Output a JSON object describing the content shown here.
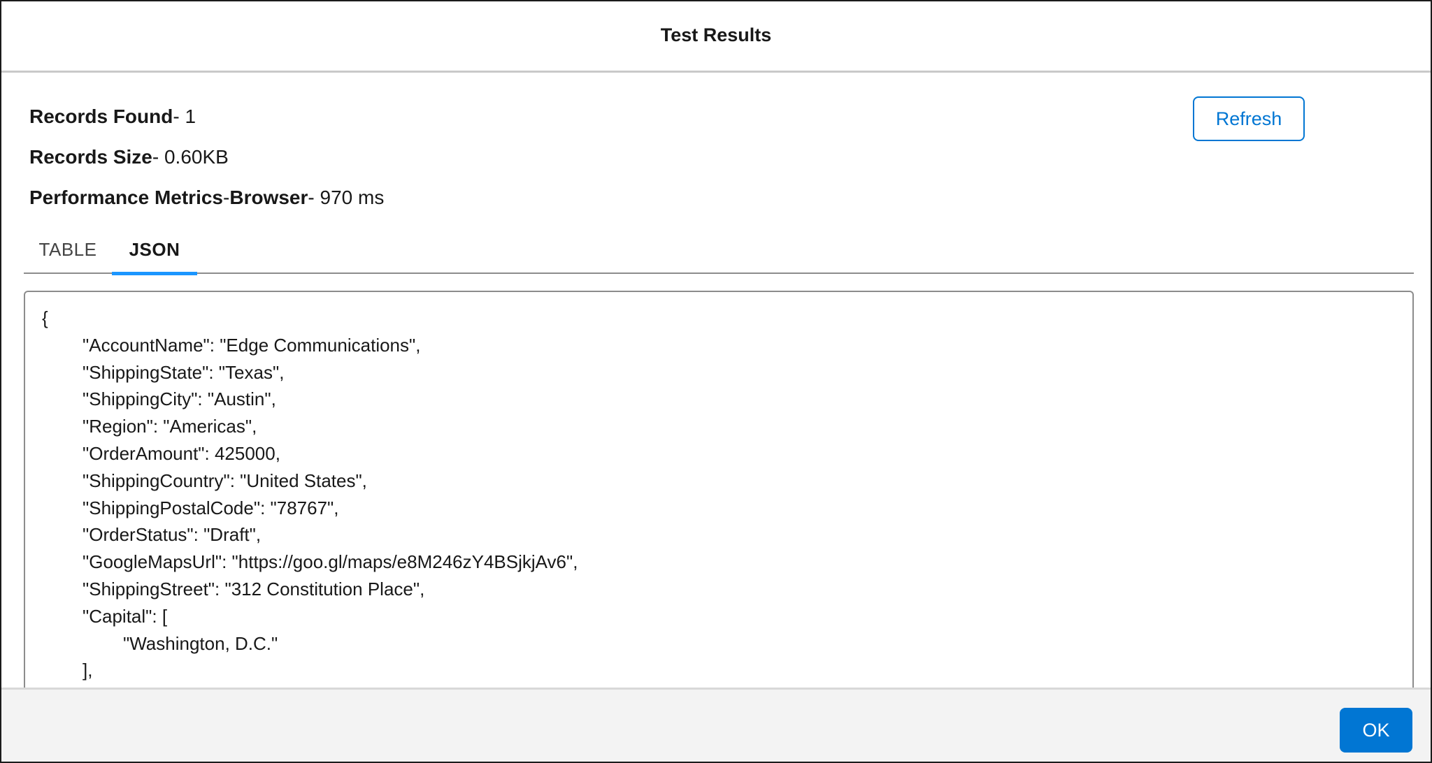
{
  "modal": {
    "title": "Test Results"
  },
  "metrics": {
    "records_found_label": "Records Found",
    "records_found_value": "- 1",
    "records_size_label": "Records Size",
    "records_size_value": "- 0.60KB",
    "performance_label_a": "Performance Metrics",
    "performance_label_sep": "-",
    "performance_label_b": "Browser",
    "performance_value": "- 970 ms"
  },
  "toolbar": {
    "refresh_label": "Refresh"
  },
  "tabs": [
    {
      "label": "TABLE",
      "active": false
    },
    {
      "label": "JSON",
      "active": true
    }
  ],
  "json_view": {
    "lines": [
      "{",
      "\"AccountName\": \"Edge Communications\",",
      "\"ShippingState\": \"Texas\",",
      "\"ShippingCity\": \"Austin\",",
      "\"Region\": \"Americas\",",
      "\"OrderAmount\": 425000,",
      "\"ShippingCountry\": \"United States\",",
      "\"ShippingPostalCode\": \"78767\",",
      "\"OrderStatus\": \"Draft\",",
      "\"GoogleMapsUrl\": \"https://goo.gl/maps/e8M246zY4BSjkjAv6\",",
      "\"ShippingStreet\": \"312 Constitution Place\",",
      "\"Capital\": [",
      "\"Washington, D.C.\"",
      "],"
    ]
  },
  "footer": {
    "ok_label": "OK"
  },
  "colors": {
    "brand_blue": "#0176d3",
    "active_tab_indicator": "#1b96ff",
    "footer_bg": "#f3f3f3"
  }
}
